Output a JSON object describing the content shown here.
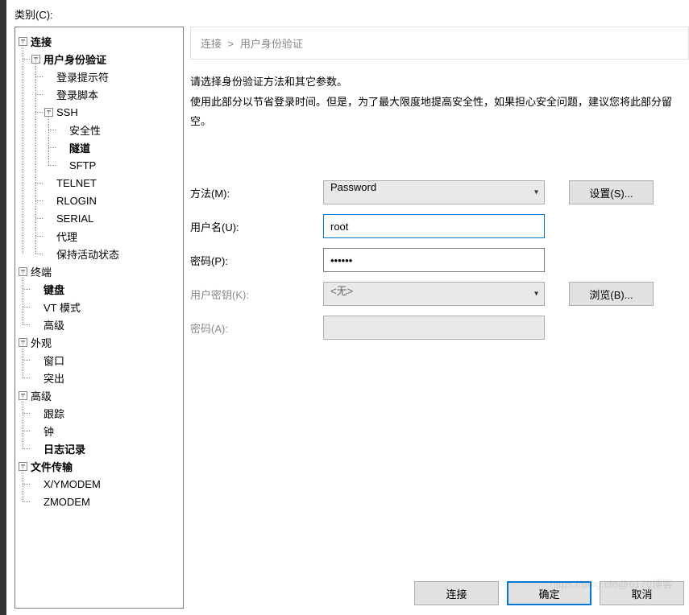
{
  "sidebar": {
    "category_label": "类别(C):",
    "tree": {
      "connection": {
        "label": "连接",
        "auth": {
          "label": "用户身份验证",
          "items": [
            "登录提示符",
            "登录脚本"
          ]
        },
        "ssh": {
          "label": "SSH",
          "items": [
            "安全性",
            "隧道",
            "SFTP"
          ]
        },
        "others": [
          "TELNET",
          "RLOGIN",
          "SERIAL",
          "代理",
          "保持活动状态"
        ]
      },
      "terminal": {
        "label": "终端",
        "items": [
          "键盘",
          "VT 模式",
          "高级"
        ]
      },
      "appearance": {
        "label": "外观",
        "items": [
          "窗口",
          "突出"
        ]
      },
      "advanced": {
        "label": "高级",
        "items": [
          "跟踪",
          "钟",
          "日志记录"
        ]
      },
      "file_transfer": {
        "label": "文件传输",
        "items": [
          "X/YMODEM",
          "ZMODEM"
        ]
      }
    }
  },
  "breadcrumb": {
    "parent": "连接",
    "current": "用户身份验证"
  },
  "description": {
    "line1": "请选择身份验证方法和其它参数。",
    "line2": "使用此部分以节省登录时间。但是，为了最大限度地提高安全性，如果担心安全问题，建议您将此部分留空。"
  },
  "form": {
    "method_label": "方法(M):",
    "method_value": "Password",
    "settings_btn": "设置(S)...",
    "username_label": "用户名(U):",
    "username_value": "root",
    "password_label": "密码(P):",
    "password_value": "••••••",
    "userkey_label": "用户密钥(K):",
    "userkey_value": "<无>",
    "browse_btn": "浏览(B)...",
    "keypass_label": "密码(A):"
  },
  "buttons": {
    "connect": "连接",
    "ok": "确定",
    "cancel": "取消"
  },
  "watermark": "https://blog.cto@6170博客"
}
